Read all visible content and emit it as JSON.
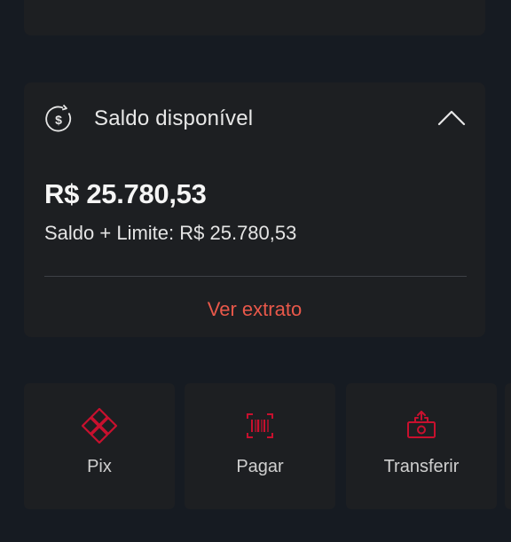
{
  "balance": {
    "title": "Saldo disponível",
    "value": "R$ 25.780,53",
    "limit": "Saldo + Limite: R$ 25.780,53",
    "link": "Ver extrato",
    "icon": "dollar-refresh-icon",
    "toggle_icon": "chevron-up-icon"
  },
  "actions": [
    {
      "label": "Pix",
      "icon": "pix-icon"
    },
    {
      "label": "Pagar",
      "icon": "barcode-icon"
    },
    {
      "label": "Transferir",
      "icon": "transfer-icon"
    }
  ],
  "colors": {
    "background": "#161b22",
    "card": "#1d1f22",
    "accent": "#e8584a",
    "icon_red": "#c8102e"
  }
}
